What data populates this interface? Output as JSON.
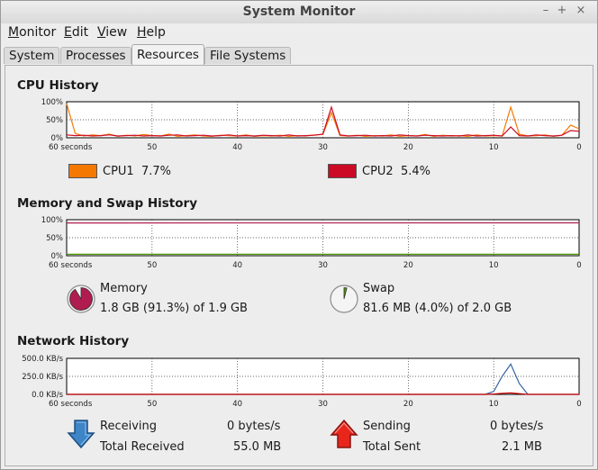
{
  "window": {
    "title": "System Monitor"
  },
  "window_controls": {
    "minimize": "–",
    "maximize": "+",
    "close": "×"
  },
  "menu": [
    {
      "label": "Monitor",
      "mnemonic": "M",
      "rest": "onitor"
    },
    {
      "label": "Edit",
      "mnemonic": "E",
      "rest": "dit"
    },
    {
      "label": "View",
      "mnemonic": "V",
      "rest": "iew"
    },
    {
      "label": "Help",
      "mnemonic": "H",
      "rest": "elp"
    }
  ],
  "tabs": [
    {
      "label": "System",
      "active": false
    },
    {
      "label": "Processes",
      "active": false
    },
    {
      "label": "Resources",
      "active": true
    },
    {
      "label": "File Systems",
      "active": false
    }
  ],
  "x_tick_labels": [
    "60 seconds",
    "50",
    "40",
    "30",
    "20",
    "10",
    "0"
  ],
  "cpu": {
    "title": "CPU History",
    "y_tick_labels": [
      "100%",
      "50%",
      "0%"
    ],
    "legend": [
      {
        "name": "CPU1",
        "value": "7.7%",
        "color": "#f57900"
      },
      {
        "name": "CPU2",
        "value": "5.4%",
        "color": "#cc0a25"
      }
    ]
  },
  "memory": {
    "title": "Memory and Swap History",
    "y_tick_labels": [
      "100%",
      "50%",
      "0%"
    ],
    "mem_label": "Memory",
    "mem_value": "1.8 GB (91.3%) of 1.9 GB",
    "mem_fraction": 0.913,
    "mem_color": "#b01c4f",
    "swap_label": "Swap",
    "swap_value": "81.6 MB (4.0%) of 2.0 GB",
    "swap_fraction": 0.04,
    "swap_color": "#4e9a06"
  },
  "network": {
    "title": "Network History",
    "y_tick_labels": [
      "500.0 KB/s",
      "250.0 KB/s",
      "0.0 KB/s"
    ],
    "receiving_label": "Receiving",
    "receiving_value": "0 bytes/s",
    "total_received_label": "Total Received",
    "total_received_value": "55.0 MB",
    "sending_label": "Sending",
    "sending_value": "0 bytes/s",
    "total_sent_label": "Total Sent",
    "total_sent_value": "2.1 MB",
    "receive_color": "#3465a4",
    "send_color": "#cc0000"
  },
  "chart_data": [
    {
      "type": "line",
      "title": "CPU History",
      "x": [
        60,
        59,
        58,
        57,
        56,
        55,
        54,
        53,
        52,
        51,
        50,
        49,
        48,
        47,
        46,
        45,
        44,
        43,
        42,
        41,
        40,
        39,
        38,
        37,
        36,
        35,
        34,
        33,
        32,
        31,
        30,
        29,
        28,
        27,
        26,
        25,
        24,
        23,
        22,
        21,
        20,
        19,
        18,
        17,
        16,
        15,
        14,
        13,
        12,
        11,
        10,
        9,
        8,
        7,
        6,
        5,
        4,
        3,
        2,
        1,
        0
      ],
      "xlabel": "seconds",
      "ylim": [
        0,
        100
      ],
      "series": [
        {
          "name": "CPU1",
          "values": [
            95,
            12,
            5,
            8,
            6,
            10,
            4,
            7,
            5,
            9,
            6,
            5,
            10,
            4,
            6,
            8,
            5,
            4,
            7,
            6,
            5,
            8,
            4,
            6,
            5,
            7,
            4,
            6,
            5,
            8,
            9,
            70,
            6,
            5,
            7,
            4,
            6,
            5,
            8,
            4,
            6,
            5,
            9,
            4,
            7,
            5,
            6,
            4,
            8,
            5,
            6,
            5,
            85,
            10,
            5,
            6,
            8,
            4,
            7,
            35,
            25
          ]
        },
        {
          "name": "CPU2",
          "values": [
            8,
            6,
            7,
            5,
            6,
            8,
            5,
            6,
            7,
            5,
            6,
            5,
            7,
            8,
            5,
            6,
            7,
            5,
            6,
            8,
            5,
            6,
            5,
            7,
            6,
            5,
            8,
            5,
            6,
            7,
            10,
            85,
            8,
            5,
            6,
            7,
            5,
            6,
            5,
            8,
            6,
            5,
            7,
            6,
            5,
            6,
            5,
            8,
            5,
            6,
            7,
            5,
            30,
            6,
            5,
            8,
            6,
            5,
            7,
            20,
            18
          ]
        }
      ]
    },
    {
      "type": "line",
      "title": "Memory and Swap History",
      "x": [
        60,
        0
      ],
      "ylim": [
        0,
        100
      ],
      "series": [
        {
          "name": "Memory",
          "values": [
            91,
            91.3
          ]
        },
        {
          "name": "Swap",
          "values": [
            4,
            4
          ]
        }
      ]
    },
    {
      "type": "line",
      "title": "Network History",
      "x": [
        60,
        50,
        40,
        30,
        20,
        12,
        11,
        10,
        9,
        8,
        7,
        6,
        5,
        0
      ],
      "ylim": [
        0,
        500
      ],
      "series": [
        {
          "name": "Receiving",
          "values": [
            0,
            0,
            0,
            0,
            0,
            0,
            0,
            40,
            250,
            420,
            150,
            0,
            0,
            0
          ]
        },
        {
          "name": "Sending",
          "values": [
            0,
            0,
            0,
            0,
            0,
            0,
            0,
            5,
            15,
            20,
            10,
            0,
            0,
            0
          ]
        }
      ]
    }
  ]
}
